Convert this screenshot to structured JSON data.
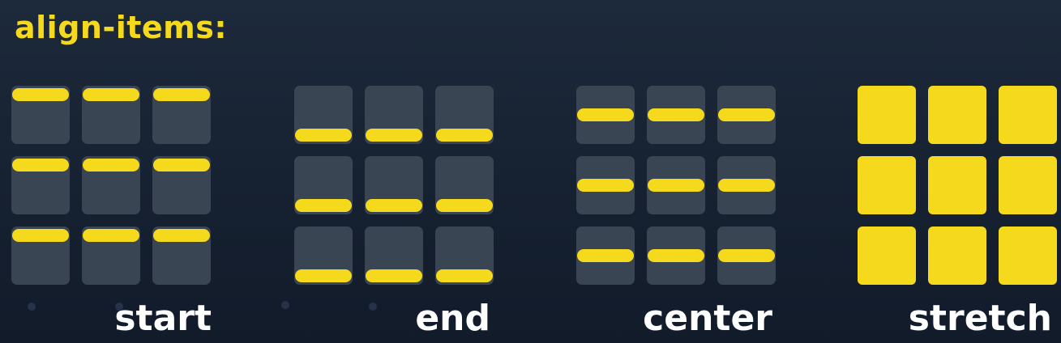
{
  "title": "align-items:",
  "colors": {
    "accent": "#f5d91d",
    "cell": "#3a4554",
    "background": "#18233a",
    "label": "#ffffff"
  },
  "panels": [
    {
      "key": "start",
      "label": "start",
      "align": "start"
    },
    {
      "key": "end",
      "label": "end",
      "align": "end"
    },
    {
      "key": "center",
      "label": "center",
      "align": "center"
    },
    {
      "key": "stretch",
      "label": "stretch",
      "align": "stretch"
    }
  ]
}
